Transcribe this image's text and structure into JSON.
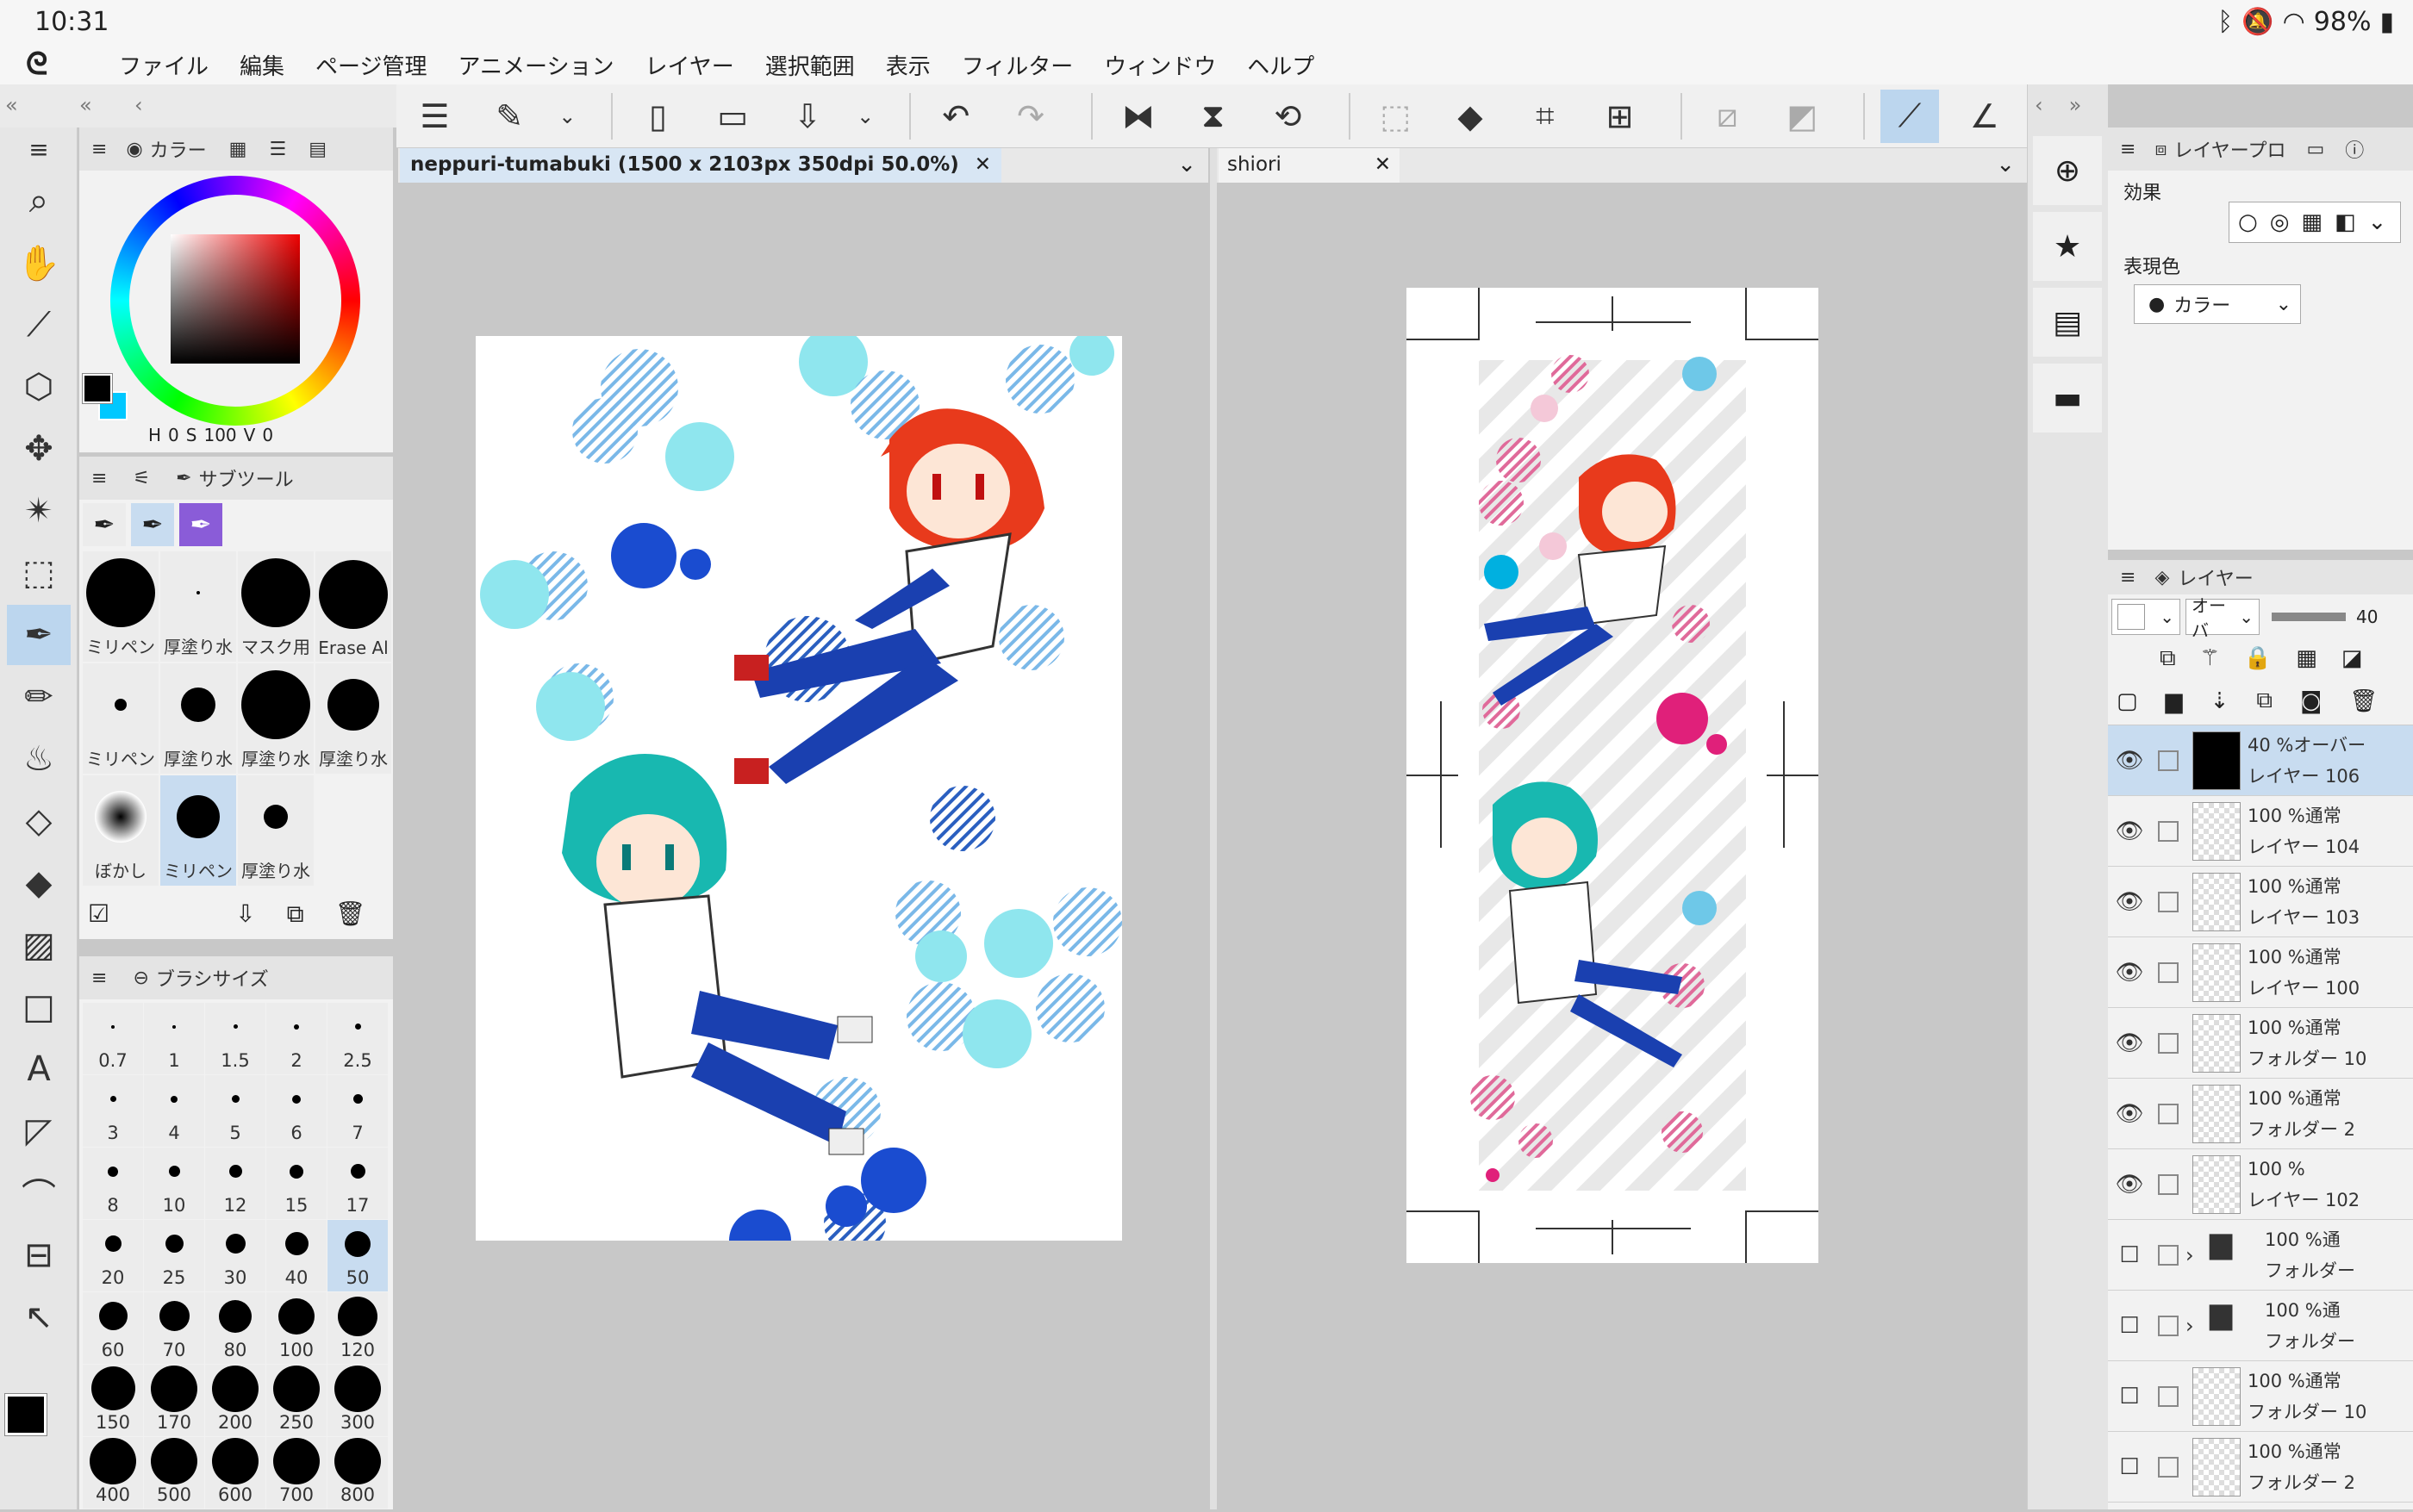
{
  "status": {
    "time": "10:31",
    "battery": "98%"
  },
  "menu": [
    "ファイル",
    "編集",
    "ページ管理",
    "アニメーション",
    "レイヤー",
    "選択範囲",
    "表示",
    "フィルター",
    "ウィンドウ",
    "ヘルプ"
  ],
  "color_panel": {
    "tab_label": "カラー",
    "h_label": "H",
    "h_value": "0",
    "s_label": "S",
    "s_value": "100",
    "v_label": "V",
    "v_value": "0",
    "main_color": "#000000",
    "sub_color": "#00c8ff"
  },
  "subtool_panel": {
    "tab_label": "サブツール",
    "brushes": [
      {
        "label": "ミリペン",
        "size": 80
      },
      {
        "label": "厚塗り水",
        "size": 4
      },
      {
        "label": "マスク用",
        "size": 80
      },
      {
        "label": "Erase Al",
        "size": 80
      },
      {
        "label": "ミリペン",
        "size": 14
      },
      {
        "label": "厚塗り水",
        "size": 40
      },
      {
        "label": "厚塗り水",
        "size": 80
      },
      {
        "label": "厚塗り水",
        "size": 60
      },
      {
        "label": "ぼかし",
        "size": 60
      },
      {
        "label": "ミリペン",
        "size": 50
      },
      {
        "label": "厚塗り水",
        "size": 28
      }
    ],
    "selected_brush": 9
  },
  "brush_size_panel": {
    "tab_label": "ブラシサイズ",
    "sizes": [
      "0.7",
      "1",
      "1.5",
      "2",
      "2.5",
      "3",
      "4",
      "5",
      "6",
      "7",
      "8",
      "10",
      "12",
      "15",
      "17",
      "20",
      "25",
      "30",
      "40",
      "50",
      "60",
      "70",
      "80",
      "100",
      "120",
      "150",
      "170",
      "200",
      "250",
      "300",
      "400",
      "500",
      "600",
      "700",
      "800"
    ],
    "selected": "50"
  },
  "documents": [
    {
      "title": "neppuri-tumabuki (1500 x 2103px 350dpi 50.0%)"
    },
    {
      "title": "shiori"
    }
  ],
  "property_panel": {
    "tab_label": "レイヤープロ",
    "effect_label": "効果",
    "color_label": "表現色",
    "color_value": "カラー"
  },
  "layer_panel": {
    "tab_label": "レイヤー",
    "blend_mode": "オーバ",
    "opacity": "40",
    "layers": [
      {
        "mode": "40 %オーバー",
        "name": "レイヤー 106",
        "visible": true,
        "thumb": "black",
        "selected": true
      },
      {
        "mode": "100 %通常",
        "name": "レイヤー 104",
        "visible": true,
        "thumb": "checker"
      },
      {
        "mode": "100 %通常",
        "name": "レイヤー 103",
        "visible": true,
        "thumb": "checker"
      },
      {
        "mode": "100 %通常",
        "name": "レイヤー 100",
        "visible": true,
        "thumb": "checker"
      },
      {
        "mode": "100 %通常",
        "name": "フォルダー 10",
        "visible": true,
        "thumb": "checker"
      },
      {
        "mode": "100 %通常",
        "name": "フォルダー 2",
        "visible": true,
        "thumb": "checker"
      },
      {
        "mode": "100 %",
        "name": "レイヤー 102",
        "visible": true,
        "thumb": "checker"
      },
      {
        "mode": "100 %通",
        "name": "フォルダー",
        "visible": false,
        "thumb": "folder"
      },
      {
        "mode": "100 %通",
        "name": "フォルダー",
        "visible": false,
        "thumb": "folder"
      },
      {
        "mode": "100 %通常",
        "name": "フォルダー 10",
        "visible": false,
        "thumb": "checker"
      },
      {
        "mode": "100 %通常",
        "name": "フォルダー 2",
        "visible": false,
        "thumb": "checker"
      }
    ]
  }
}
